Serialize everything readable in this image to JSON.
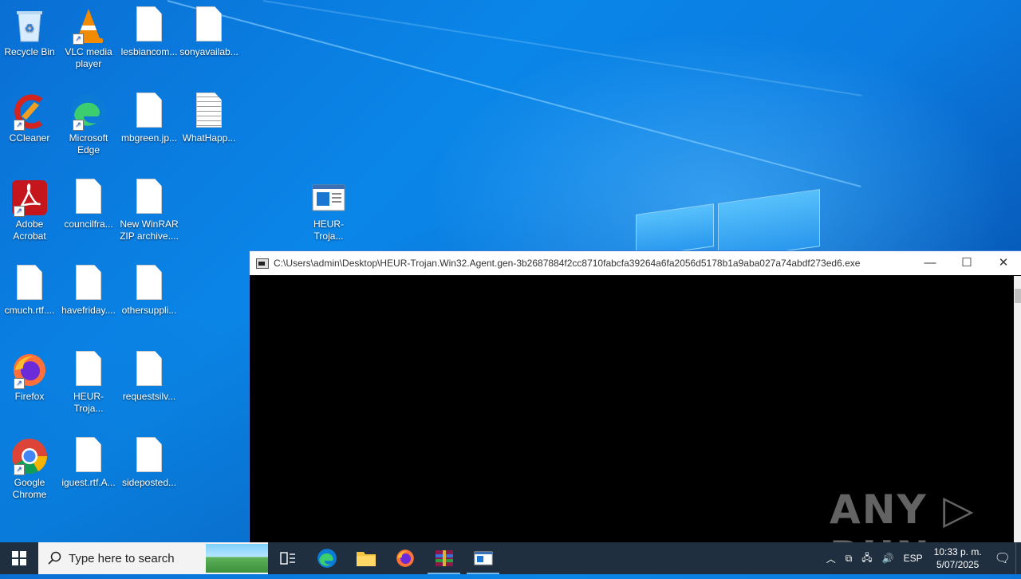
{
  "desktop": {
    "icons": [
      {
        "label": "Recycle Bin"
      },
      {
        "label": "VLC media player"
      },
      {
        "label": "lesbiancom..."
      },
      {
        "label": "sonyavailab..."
      },
      {
        "label": "CCleaner"
      },
      {
        "label": "Microsoft Edge"
      },
      {
        "label": "mbgreen.jp..."
      },
      {
        "label": "WhatHapp..."
      },
      {
        "label": "Adobe Acrobat"
      },
      {
        "label": "councilfra..."
      },
      {
        "label": "New WinRAR ZIP archive...."
      },
      {
        "label": "HEUR-Troja..."
      },
      {
        "label": "cmuch.rtf...."
      },
      {
        "label": "havefriday...."
      },
      {
        "label": "othersuppli..."
      },
      {
        "label": "Firefox"
      },
      {
        "label": "HEUR-Troja..."
      },
      {
        "label": "requestsilv..."
      },
      {
        "label": "Google Chrome"
      },
      {
        "label": "iguest.rtf.A..."
      },
      {
        "label": "sideposted..."
      }
    ]
  },
  "console": {
    "title": "C:\\Users\\admin\\Desktop\\HEUR-Trojan.Win32.Agent.gen-3b2687884f2cc8710fabcfa39264a6fa2056d5178b1a9aba027a74abdf273ed6.exe",
    "minimize": "—",
    "maximize": "☐",
    "close": "✕"
  },
  "watermark": "ANY ▷ RUN",
  "taskbar": {
    "search_placeholder": "Type here to search",
    "language": "ESP",
    "time": "10:33 p. m.",
    "date": "5/07/2025"
  },
  "colors": {
    "taskbar": "#1f2f3f",
    "console_bg": "#000000",
    "wallpaper": "#0a86e8"
  }
}
